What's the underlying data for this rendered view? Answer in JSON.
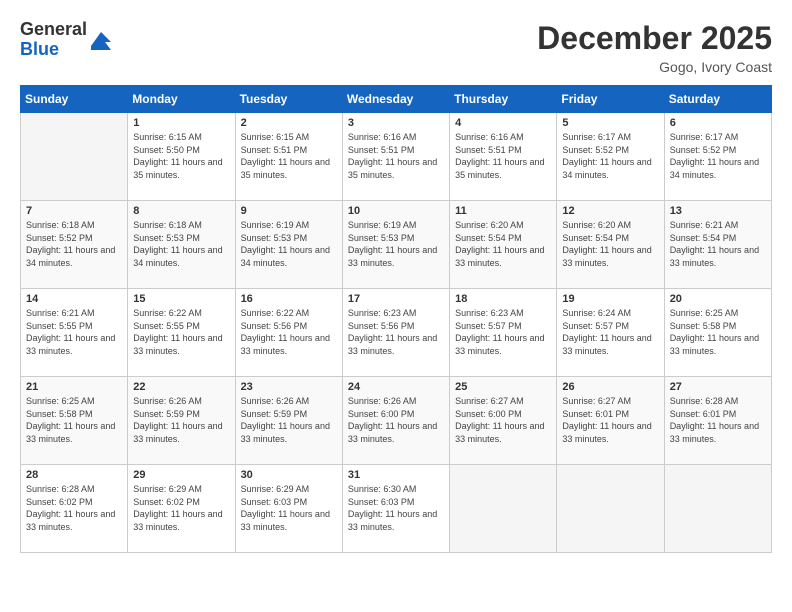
{
  "header": {
    "logo_general": "General",
    "logo_blue": "Blue",
    "month_title": "December 2025",
    "location": "Gogo, Ivory Coast"
  },
  "days_of_week": [
    "Sunday",
    "Monday",
    "Tuesday",
    "Wednesday",
    "Thursday",
    "Friday",
    "Saturday"
  ],
  "weeks": [
    [
      {
        "day": "",
        "sunrise": "",
        "sunset": "",
        "daylight": ""
      },
      {
        "day": "1",
        "sunrise": "Sunrise: 6:15 AM",
        "sunset": "Sunset: 5:50 PM",
        "daylight": "Daylight: 11 hours and 35 minutes."
      },
      {
        "day": "2",
        "sunrise": "Sunrise: 6:15 AM",
        "sunset": "Sunset: 5:51 PM",
        "daylight": "Daylight: 11 hours and 35 minutes."
      },
      {
        "day": "3",
        "sunrise": "Sunrise: 6:16 AM",
        "sunset": "Sunset: 5:51 PM",
        "daylight": "Daylight: 11 hours and 35 minutes."
      },
      {
        "day": "4",
        "sunrise": "Sunrise: 6:16 AM",
        "sunset": "Sunset: 5:51 PM",
        "daylight": "Daylight: 11 hours and 35 minutes."
      },
      {
        "day": "5",
        "sunrise": "Sunrise: 6:17 AM",
        "sunset": "Sunset: 5:52 PM",
        "daylight": "Daylight: 11 hours and 34 minutes."
      },
      {
        "day": "6",
        "sunrise": "Sunrise: 6:17 AM",
        "sunset": "Sunset: 5:52 PM",
        "daylight": "Daylight: 11 hours and 34 minutes."
      }
    ],
    [
      {
        "day": "7",
        "sunrise": "Sunrise: 6:18 AM",
        "sunset": "Sunset: 5:52 PM",
        "daylight": "Daylight: 11 hours and 34 minutes."
      },
      {
        "day": "8",
        "sunrise": "Sunrise: 6:18 AM",
        "sunset": "Sunset: 5:53 PM",
        "daylight": "Daylight: 11 hours and 34 minutes."
      },
      {
        "day": "9",
        "sunrise": "Sunrise: 6:19 AM",
        "sunset": "Sunset: 5:53 PM",
        "daylight": "Daylight: 11 hours and 34 minutes."
      },
      {
        "day": "10",
        "sunrise": "Sunrise: 6:19 AM",
        "sunset": "Sunset: 5:53 PM",
        "daylight": "Daylight: 11 hours and 33 minutes."
      },
      {
        "day": "11",
        "sunrise": "Sunrise: 6:20 AM",
        "sunset": "Sunset: 5:54 PM",
        "daylight": "Daylight: 11 hours and 33 minutes."
      },
      {
        "day": "12",
        "sunrise": "Sunrise: 6:20 AM",
        "sunset": "Sunset: 5:54 PM",
        "daylight": "Daylight: 11 hours and 33 minutes."
      },
      {
        "day": "13",
        "sunrise": "Sunrise: 6:21 AM",
        "sunset": "Sunset: 5:54 PM",
        "daylight": "Daylight: 11 hours and 33 minutes."
      }
    ],
    [
      {
        "day": "14",
        "sunrise": "Sunrise: 6:21 AM",
        "sunset": "Sunset: 5:55 PM",
        "daylight": "Daylight: 11 hours and 33 minutes."
      },
      {
        "day": "15",
        "sunrise": "Sunrise: 6:22 AM",
        "sunset": "Sunset: 5:55 PM",
        "daylight": "Daylight: 11 hours and 33 minutes."
      },
      {
        "day": "16",
        "sunrise": "Sunrise: 6:22 AM",
        "sunset": "Sunset: 5:56 PM",
        "daylight": "Daylight: 11 hours and 33 minutes."
      },
      {
        "day": "17",
        "sunrise": "Sunrise: 6:23 AM",
        "sunset": "Sunset: 5:56 PM",
        "daylight": "Daylight: 11 hours and 33 minutes."
      },
      {
        "day": "18",
        "sunrise": "Sunrise: 6:23 AM",
        "sunset": "Sunset: 5:57 PM",
        "daylight": "Daylight: 11 hours and 33 minutes."
      },
      {
        "day": "19",
        "sunrise": "Sunrise: 6:24 AM",
        "sunset": "Sunset: 5:57 PM",
        "daylight": "Daylight: 11 hours and 33 minutes."
      },
      {
        "day": "20",
        "sunrise": "Sunrise: 6:25 AM",
        "sunset": "Sunset: 5:58 PM",
        "daylight": "Daylight: 11 hours and 33 minutes."
      }
    ],
    [
      {
        "day": "21",
        "sunrise": "Sunrise: 6:25 AM",
        "sunset": "Sunset: 5:58 PM",
        "daylight": "Daylight: 11 hours and 33 minutes."
      },
      {
        "day": "22",
        "sunrise": "Sunrise: 6:26 AM",
        "sunset": "Sunset: 5:59 PM",
        "daylight": "Daylight: 11 hours and 33 minutes."
      },
      {
        "day": "23",
        "sunrise": "Sunrise: 6:26 AM",
        "sunset": "Sunset: 5:59 PM",
        "daylight": "Daylight: 11 hours and 33 minutes."
      },
      {
        "day": "24",
        "sunrise": "Sunrise: 6:26 AM",
        "sunset": "Sunset: 6:00 PM",
        "daylight": "Daylight: 11 hours and 33 minutes."
      },
      {
        "day": "25",
        "sunrise": "Sunrise: 6:27 AM",
        "sunset": "Sunset: 6:00 PM",
        "daylight": "Daylight: 11 hours and 33 minutes."
      },
      {
        "day": "26",
        "sunrise": "Sunrise: 6:27 AM",
        "sunset": "Sunset: 6:01 PM",
        "daylight": "Daylight: 11 hours and 33 minutes."
      },
      {
        "day": "27",
        "sunrise": "Sunrise: 6:28 AM",
        "sunset": "Sunset: 6:01 PM",
        "daylight": "Daylight: 11 hours and 33 minutes."
      }
    ],
    [
      {
        "day": "28",
        "sunrise": "Sunrise: 6:28 AM",
        "sunset": "Sunset: 6:02 PM",
        "daylight": "Daylight: 11 hours and 33 minutes."
      },
      {
        "day": "29",
        "sunrise": "Sunrise: 6:29 AM",
        "sunset": "Sunset: 6:02 PM",
        "daylight": "Daylight: 11 hours and 33 minutes."
      },
      {
        "day": "30",
        "sunrise": "Sunrise: 6:29 AM",
        "sunset": "Sunset: 6:03 PM",
        "daylight": "Daylight: 11 hours and 33 minutes."
      },
      {
        "day": "31",
        "sunrise": "Sunrise: 6:30 AM",
        "sunset": "Sunset: 6:03 PM",
        "daylight": "Daylight: 11 hours and 33 minutes."
      },
      {
        "day": "",
        "sunrise": "",
        "sunset": "",
        "daylight": ""
      },
      {
        "day": "",
        "sunrise": "",
        "sunset": "",
        "daylight": ""
      },
      {
        "day": "",
        "sunrise": "",
        "sunset": "",
        "daylight": ""
      }
    ]
  ]
}
